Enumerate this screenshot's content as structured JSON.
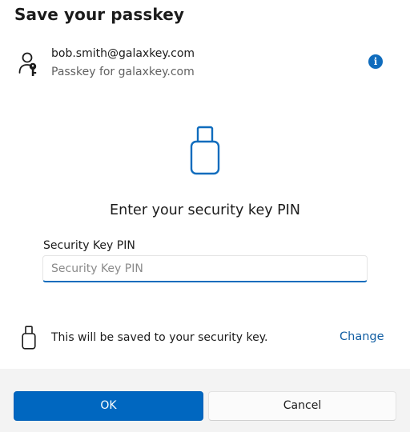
{
  "dialog": {
    "title": "Save your passkey"
  },
  "account": {
    "icon": "person-key-icon",
    "email": "bob.smith@galaxkey.com",
    "subtitle": "Passkey for galaxkey.com",
    "info_icon": "info-icon",
    "info_glyph": "i"
  },
  "security_key": {
    "graphic_icon": "usb-security-key-icon",
    "prompt": "Enter your security key PIN",
    "pin_label": "Security Key PIN",
    "pin_value": "",
    "pin_placeholder": "Security Key PIN"
  },
  "save_info": {
    "icon": "usb-security-key-icon",
    "text": "This will be saved to your security key.",
    "change_label": "Change"
  },
  "footer": {
    "ok_label": "OK",
    "cancel_label": "Cancel"
  },
  "colors": {
    "accent": "#0067c0",
    "link": "#115ea3",
    "footer_bg": "#f3f3f3"
  }
}
